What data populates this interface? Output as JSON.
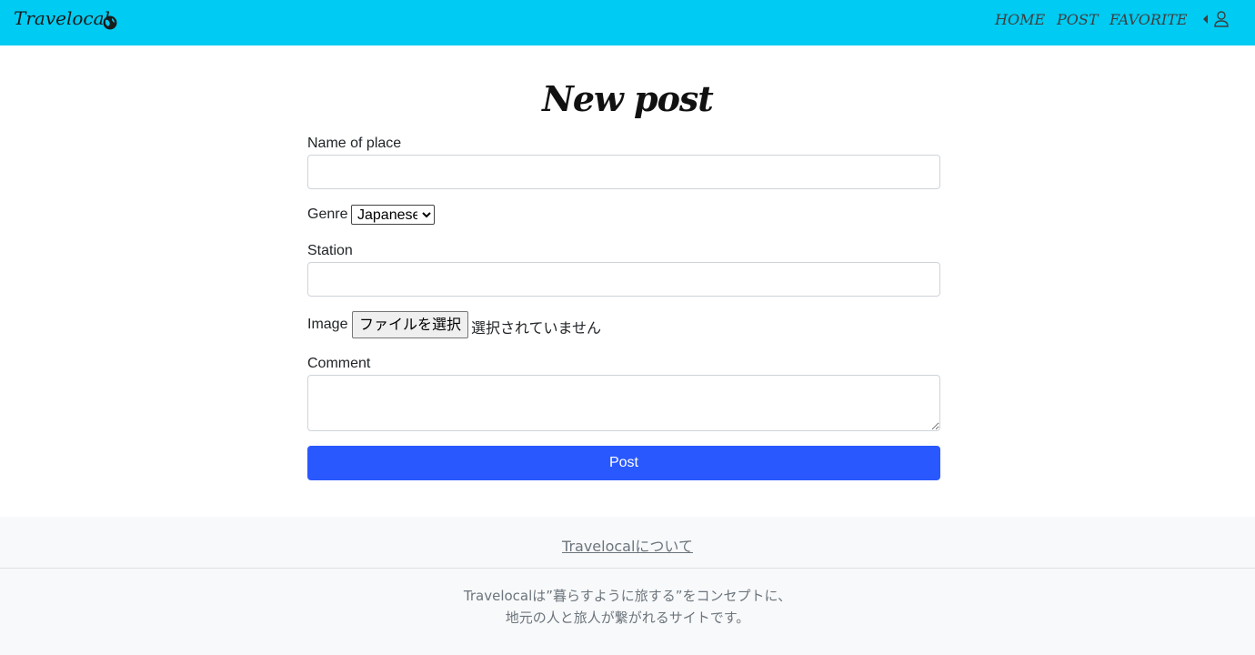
{
  "navbar": {
    "brand": "Travelocal",
    "links": [
      "HOME",
      "POST",
      "FAVORITE"
    ],
    "colors": {
      "background": "#00cbf2"
    }
  },
  "page": {
    "title": "New post"
  },
  "form": {
    "name_label": "Name of place",
    "name_value": "",
    "genre_label": "Genre",
    "genre_selected": "Japanese",
    "station_label": "Station",
    "station_value": "",
    "image_label": "Image",
    "file_button": "ファイルを選択",
    "file_status": "選択されていません",
    "comment_label": "Comment",
    "comment_value": "",
    "submit_label": "Post",
    "submit_color": "#2a58ff"
  },
  "footer": {
    "about_link": "Travelocalについて",
    "line1": "Travelocalは”暮らすように旅する”をコンセプトに、",
    "line2": "地元の人と旅人が繋がれるサイトです。"
  }
}
